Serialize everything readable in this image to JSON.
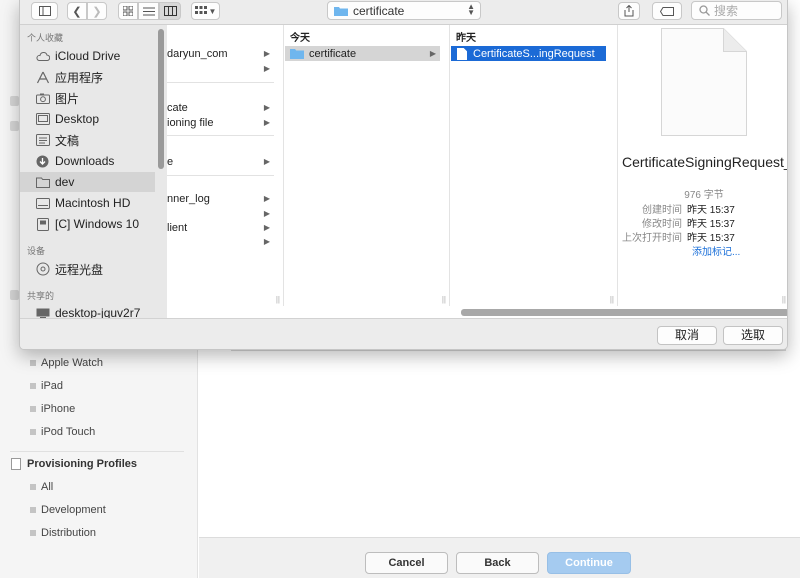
{
  "background": {
    "sidebar": {
      "device_items": [
        "Apple Watch",
        "iPad",
        "iPhone",
        "iPod Touch"
      ],
      "profiles_header": "Provisioning Profiles",
      "profile_items": [
        "All",
        "Development",
        "Distribution"
      ]
    },
    "buttons": {
      "cancel": "Cancel",
      "back": "Back",
      "continue": "Continue"
    }
  },
  "dialog": {
    "path": "certificate",
    "search_placeholder": "搜索",
    "sidebar": {
      "favorites_header": "个人收藏",
      "favorites": [
        {
          "label": "iCloud Drive",
          "icon": "cloud-icon"
        },
        {
          "label": "应用程序",
          "icon": "applications-icon"
        },
        {
          "label": "图片",
          "icon": "camera-icon"
        },
        {
          "label": "Desktop",
          "icon": "desktop-folder-icon"
        },
        {
          "label": "文稿",
          "icon": "documents-icon"
        },
        {
          "label": "Downloads",
          "icon": "downloads-icon"
        },
        {
          "label": "dev",
          "icon": "folder-icon"
        }
      ],
      "devices_header": "设备",
      "devices": [
        {
          "label": "Macintosh HD",
          "icon": "drive-icon"
        },
        {
          "label": "[C] Windows 10",
          "icon": "drive-icon"
        },
        {
          "label": "远程光盘",
          "icon": "disc-icon"
        }
      ],
      "shared_header": "共享的",
      "shared": [
        {
          "label": "desktop-jquv2r7",
          "icon": "computer-icon"
        }
      ]
    },
    "column1": {
      "rows": [
        {
          "label": "daryun_com",
          "arrow": true
        },
        {
          "label": "",
          "arrow": true
        },
        {
          "label": "cate",
          "arrow": true
        },
        {
          "label": "ioning file",
          "arrow": true
        },
        {
          "label": "e",
          "arrow": true
        },
        {
          "label": "nner_log",
          "arrow": true
        },
        {
          "label": "",
          "arrow": true
        },
        {
          "label": "lient",
          "arrow": true
        },
        {
          "label": "",
          "arrow": true
        }
      ]
    },
    "column2": {
      "header": "今天",
      "rows": [
        {
          "label": "certificate"
        }
      ]
    },
    "column3": {
      "header": "昨天",
      "rows": [
        {
          "label": "CertificateS...ingRequest"
        }
      ]
    },
    "preview": {
      "filename": "CertificateSigningRequest_JianDao_Larry.cert...",
      "size": "976 字节",
      "created_label": "创建时间",
      "created_value": "昨天 15:37",
      "modified_label": "修改时间",
      "modified_value": "昨天 15:37",
      "opened_label": "上次打开时间",
      "opened_value": "昨天 15:37",
      "add_tags": "添加标记..."
    },
    "buttons": {
      "cancel": "取消",
      "choose": "选取"
    }
  }
}
